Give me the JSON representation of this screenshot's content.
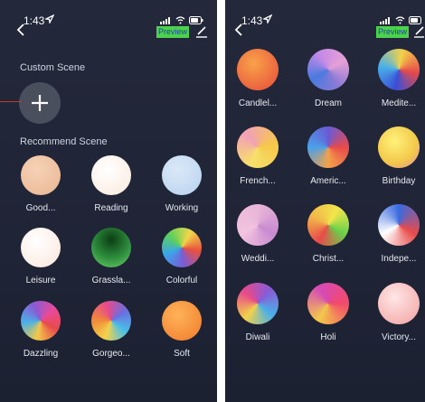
{
  "left_screen": {
    "status_time": "1:43",
    "preview_label": "Preview",
    "custom_scene_label": "Custom Scene",
    "recommend_scene_label": "Recommend Scene",
    "scenes": [
      {
        "label": "Good...",
        "color": "#f0c6a6"
      },
      {
        "label": "Reading",
        "color": "#fff1e6"
      },
      {
        "label": "Working",
        "color": "#c6dcf3"
      },
      {
        "label": "Leisure",
        "color": "#fff2ea"
      },
      {
        "label": "Grassla...",
        "color": "#2f9a46"
      },
      {
        "label": "Colorful",
        "color": "#e96b5c"
      },
      {
        "label": "Dazzling",
        "color": "#d94f7c"
      },
      {
        "label": "Gorgeo...",
        "color": "#f0a24c"
      },
      {
        "label": "Soft",
        "color": "#f58b3c"
      }
    ]
  },
  "right_screen": {
    "status_time": "1:43",
    "preview_label": "Preview",
    "scenes": [
      {
        "label": "Candlel...",
        "color": "#ec6a3a"
      },
      {
        "label": "Dream",
        "color": "#9a72c8"
      },
      {
        "label": "Medite...",
        "color": "#3f6ed8"
      },
      {
        "label": "French...",
        "color": "#f2c84a"
      },
      {
        "label": "Americ...",
        "color": "#e25c6a"
      },
      {
        "label": "Birthday",
        "color": "#f6d94a"
      },
      {
        "label": "Weddi...",
        "color": "#e6a0c4"
      },
      {
        "label": "Christ...",
        "color": "#8fd04a"
      },
      {
        "label": "Indepe...",
        "color": "#e24b4b"
      },
      {
        "label": "Diwali",
        "color": "#f2b83a"
      },
      {
        "label": "Holi",
        "color": "#e24a8a"
      },
      {
        "label": "Victory...",
        "color": "#f2a6a6"
      }
    ]
  }
}
